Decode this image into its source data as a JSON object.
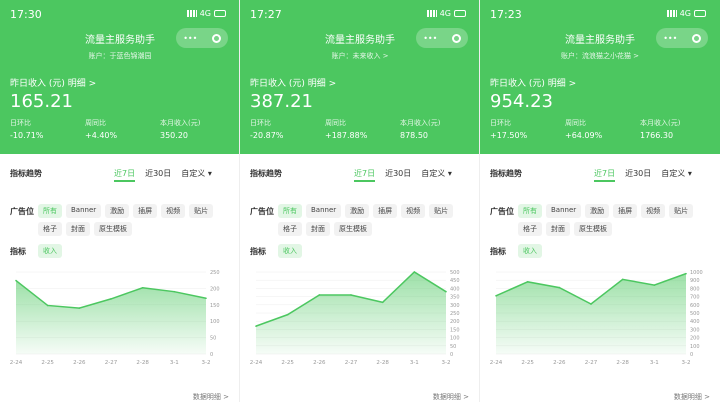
{
  "panels": [
    {
      "time": "17:30",
      "net": "4G",
      "app_title": "流量主服务助手",
      "account": "账户：于蓝色锦潮园",
      "yesterday_label": "昨日收入 (元)  明细 >",
      "yesterday_value": "165.21",
      "stats": [
        {
          "label": "日环比",
          "value": "-10.71%"
        },
        {
          "label": "周同比",
          "value": "+4.40%"
        },
        {
          "label": "本月收入(元)",
          "value": "350.20"
        }
      ]
    },
    {
      "time": "17:27",
      "net": "4G",
      "app_title": "流量主服务助手",
      "account": "账户：未来收入 >",
      "yesterday_label": "昨日收入 (元)  明细 >",
      "yesterday_value": "387.21",
      "stats": [
        {
          "label": "日环比",
          "value": "-20.87%"
        },
        {
          "label": "周同比",
          "value": "+187.88%"
        },
        {
          "label": "本月收入(元)",
          "value": "878.50"
        }
      ]
    },
    {
      "time": "17:23",
      "net": "4G",
      "app_title": "流量主服务助手",
      "account": "账户：流浪猫之小花猫 >",
      "yesterday_label": "昨日收入 (元)  明细 >",
      "yesterday_value": "954.23",
      "stats": [
        {
          "label": "日环比",
          "value": "+17.50%"
        },
        {
          "label": "周同比",
          "value": "+64.09%"
        },
        {
          "label": "本月收入(元)",
          "value": "1766.30"
        }
      ]
    }
  ],
  "common": {
    "trend_title": "指标趋势",
    "range": [
      "近7日",
      "近30日",
      "自定义 ▾"
    ],
    "adpos_label": "广告位",
    "adpos": [
      "所有",
      "Banner",
      "激励",
      "插屏",
      "视频",
      "贴片",
      "格子",
      "封面",
      "原生模板"
    ],
    "metric_label": "指标",
    "metric": "收入",
    "detail": "数据明细 >"
  },
  "chart_data": [
    {
      "type": "area",
      "categories": [
        "2-24",
        "2-25",
        "2-26",
        "2-27",
        "2-28",
        "3-1",
        "3-2"
      ],
      "values": [
        224,
        148,
        140,
        168,
        202,
        190,
        170
      ],
      "ylim": [
        0,
        250
      ],
      "ticks": [
        0,
        50,
        100,
        150,
        200,
        250
      ]
    },
    {
      "type": "area",
      "categories": [
        "2-24",
        "2-25",
        "2-26",
        "2-27",
        "2-28",
        "3-1",
        "3-2"
      ],
      "values": [
        170,
        240,
        360,
        360,
        315,
        500,
        380
      ],
      "ylim": [
        0,
        500
      ],
      "ticks": [
        0,
        50,
        100,
        150,
        200,
        250,
        300,
        350,
        400,
        450,
        500
      ]
    },
    {
      "type": "area",
      "categories": [
        "2-24",
        "2-25",
        "2-26",
        "2-27",
        "2-28",
        "3-1",
        "3-2"
      ],
      "values": [
        710,
        880,
        810,
        610,
        910,
        840,
        980
      ],
      "ylim": [
        0,
        1000
      ],
      "ticks": [
        0,
        100,
        200,
        300,
        400,
        500,
        600,
        700,
        800,
        900,
        1000
      ]
    }
  ]
}
